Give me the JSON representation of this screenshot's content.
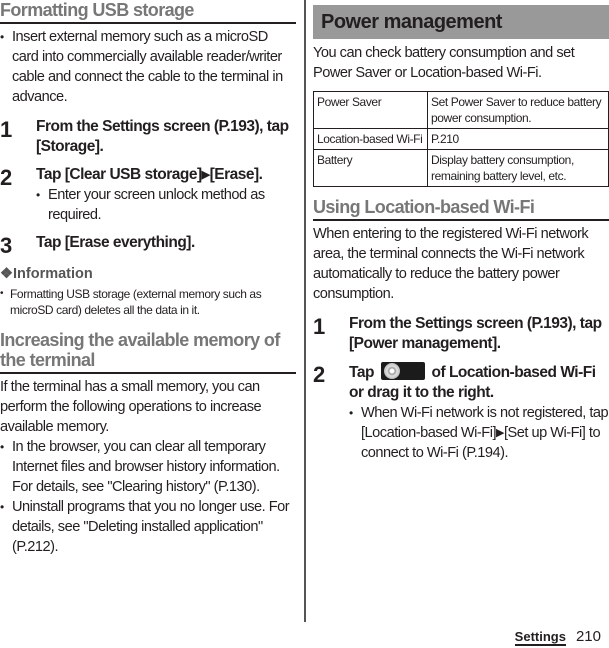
{
  "left": {
    "format_section": {
      "title": "Formatting USB storage",
      "bullet": "Insert external memory such as a microSD card into commercially available reader/writer cable and connect the cable to the terminal in advance.",
      "steps": [
        {
          "num": "1",
          "text": "From the Settings screen (P.193), tap [Storage]."
        },
        {
          "num": "2",
          "text_a": "Tap [Clear USB storage]",
          "arrow": "▶",
          "text_b": "[Erase].",
          "note": "Enter your screen unlock method as required."
        },
        {
          "num": "3",
          "text": "Tap [Erase everything]."
        }
      ],
      "info": {
        "heading": "❖Information",
        "bullet": "Formatting USB storage (external memory such as microSD card) deletes all the data in it."
      }
    },
    "memory_section": {
      "title": "Increasing the available memory of the terminal",
      "intro": "If the terminal has a small memory, you can perform the following operations to increase available memory.",
      "bullets": [
        "In the browser, you can clear all temporary Internet files and browser history information. For details, see \"Clearing history\" (P.130).",
        "Uninstall programs that you no longer use. For details, see \"Deleting installed application\" (P.212)."
      ]
    }
  },
  "right": {
    "power_header": "Power management",
    "intro": "You can check battery consumption and set Power Saver or Location-based Wi-Fi.",
    "table": [
      {
        "key": "Power Saver",
        "value": "Set Power Saver to reduce battery power consumption."
      },
      {
        "key": "Location-based Wi-Fi",
        "value": "P.210"
      },
      {
        "key": "Battery",
        "value": "Display battery consumption, remaining battery level, etc."
      }
    ],
    "wifi_section": {
      "title": "Using Location-based Wi-Fi",
      "intro": "When entering to the registered Wi-Fi network area, the terminal connects the Wi-Fi network automatically to reduce the battery power consumption.",
      "steps": [
        {
          "num": "1",
          "text": "From the Settings screen (P.193), tap [Power management]."
        },
        {
          "num": "2",
          "text_a": "Tap",
          "text_b": "of Location-based Wi-Fi or drag it to the right.",
          "note_a": "When Wi-Fi network is not registered, tap [Location-based Wi-Fi]",
          "arrow": "▶",
          "note_b": "[Set up Wi-Fi] to connect to Wi-Fi (P.194)."
        }
      ]
    }
  },
  "footer": {
    "section": "Settings",
    "page": "210"
  }
}
